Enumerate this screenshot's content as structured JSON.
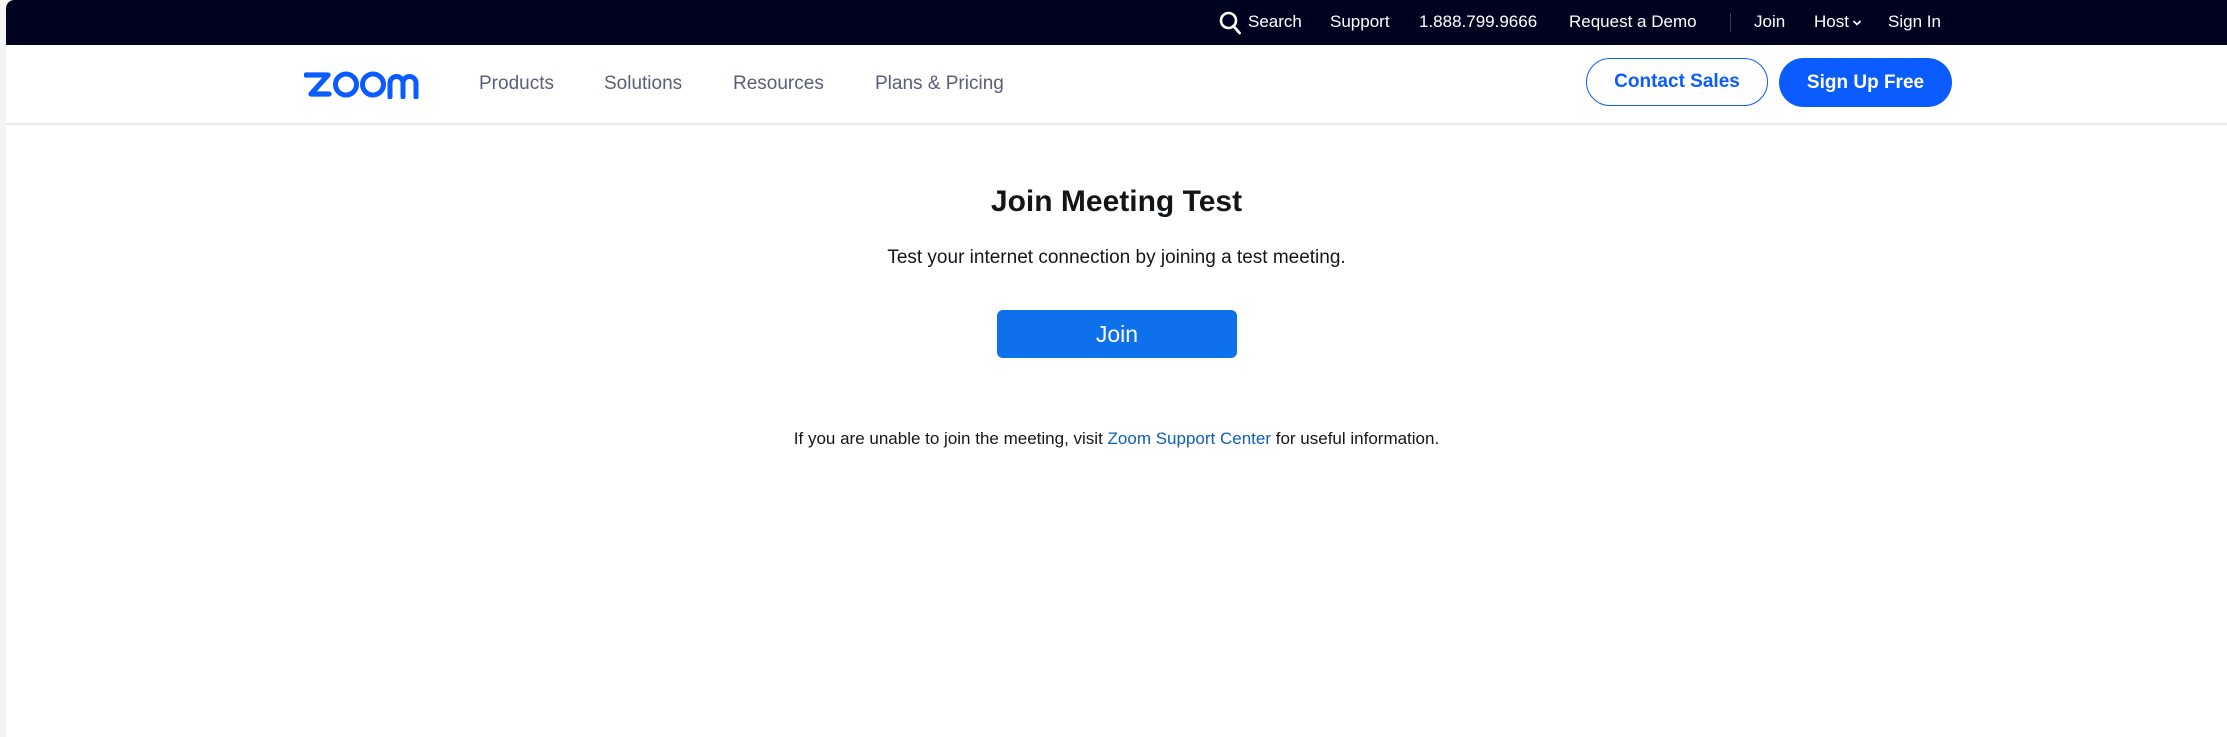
{
  "utility_bar": {
    "search_label": "Search",
    "support_label": "Support",
    "phone": "1.888.799.9666",
    "request_demo_label": "Request a Demo",
    "join_label": "Join",
    "host_label": "Host",
    "sign_in_label": "Sign In",
    "icons": {
      "search": "search-icon",
      "host_dropdown": "chevron-down-icon"
    }
  },
  "nav": {
    "logo_text": "zoom",
    "links": [
      {
        "label": "Products"
      },
      {
        "label": "Solutions"
      },
      {
        "label": "Resources"
      },
      {
        "label": "Plans & Pricing"
      }
    ],
    "contact_sales_label": "Contact Sales",
    "sign_up_label": "Sign Up Free"
  },
  "main": {
    "title": "Join Meeting Test",
    "subtitle": "Test your internet connection by joining a test meeting.",
    "join_button_label": "Join",
    "help_prefix": "If you are unable to join the meeting, visit ",
    "help_link": "Zoom Support Center",
    "help_suffix": " for useful information."
  },
  "colors": {
    "utility_bar_bg": "#00031f",
    "brand_blue": "#0b5cff",
    "join_button_bg": "#0e71eb",
    "link_blue": "#0e5fb8",
    "nav_text": "#5c5d7a",
    "body_text": "#131619"
  }
}
